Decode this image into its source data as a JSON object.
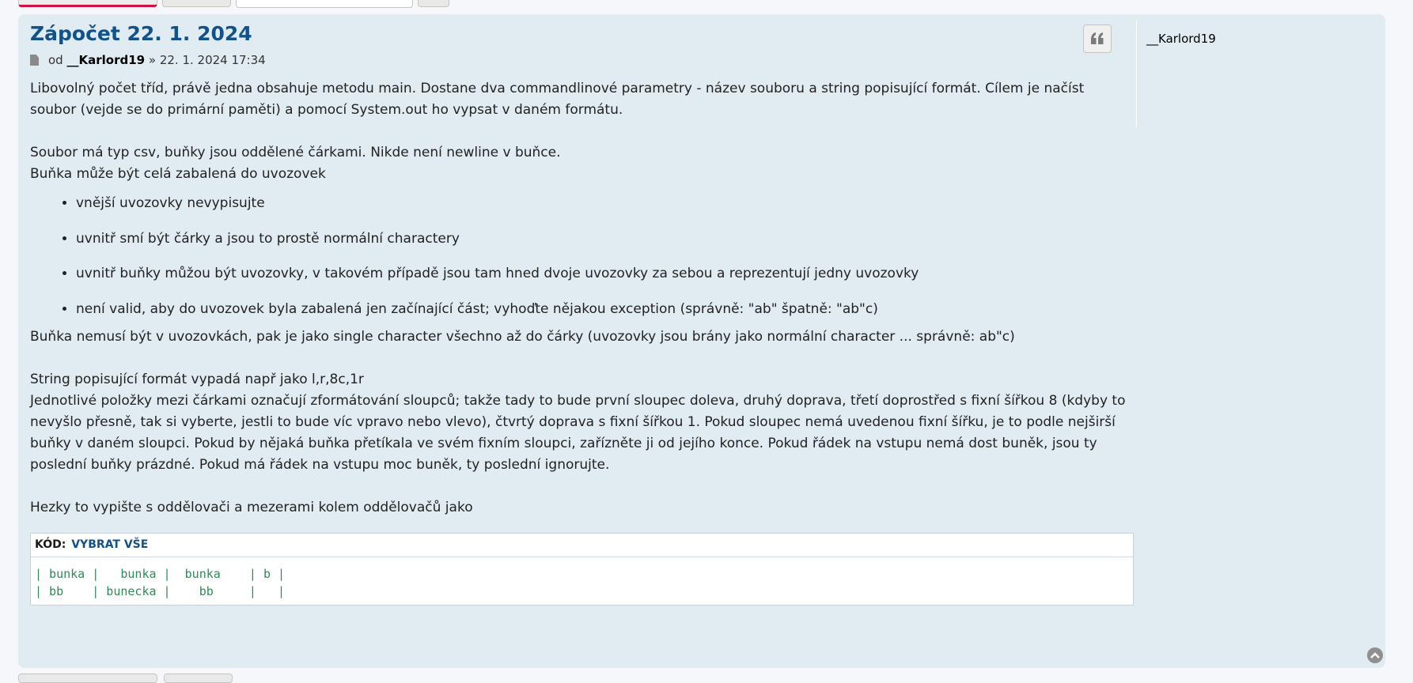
{
  "post": {
    "title": "Zápočet 22. 1. 2024",
    "author_prefix": "od",
    "author": "__Karlord19",
    "date": "» 22. 1. 2024 17:34",
    "content": {
      "p1": "Libovolný počet tříd, právě jedna obsahuje metodu main. Dostane dva commandlinové parametry - název souboru a string popisující formát. Cílem je načíst soubor (vejde se do primární paměti) a pomocí System.out ho vypsat v daném formátu.",
      "p2": "Soubor má typ csv, buňky jsou oddělené čárkami. Nikde není newline v buňce.",
      "p3": "Buňka může být celá zabalená do uvozovek",
      "list": [
        "vnější uvozovky nevypisujte",
        "uvnitř smí být čárky a jsou to prostě normální charactery",
        "uvnitř buňky můžou být uvozovky, v takovém případě jsou tam hned dvoje uvozovky za sebou a reprezentují jedny uvozovky",
        "není valid, aby do uvozovek byla zabalená jen začínající část; vyhoďte nějakou exception (správně: \"ab\" špatně: \"ab\"c)"
      ],
      "p4": "Buňka nemusí být v uvozovkách, pak je jako single character všechno až do čárky (uvozovky jsou brány jako normální character ... správně: ab\"c)",
      "p5": "String popisující formát vypadá např jako l,r,8c,1r",
      "p6": "Jednotlivé položky mezi čárkami označují zformátování sloupců; takže tady to bude první sloupec doleva, druhý doprava, třetí doprostřed s fixní šířkou 8 (kdyby to nevyšlo přesně, tak si vyberte, jestli to bude víc vpravo nebo vlevo), čtvrtý doprava s fixní šířkou 1. Pokud sloupec nemá uvedenou fixní šířku, je to podle nejširší buňky v daném sloupci. Pokud by nějaká buňka přetíkala ve svém fixním sloupci, zařízněte ji od jejího konce. Pokud řádek na vstupu nemá dost buněk, jsou ty poslední buňky prázdné. Pokud má řádek na vstupu moc buněk, ty poslední ignorujte.",
      "p7": "Hezky to vypište s oddělovači a mezerami kolem oddělovačů jako"
    },
    "code": {
      "label": "KÓD:",
      "select_all": "VYBRAT VŠE",
      "text": "| bunka |   bunka |  bunka    | b |\n| bb    | bunecka |    bb     |   |"
    }
  },
  "profile": {
    "username": "__Karlord19"
  },
  "icons": {
    "quote": "quote-icon",
    "post": "post-file-icon",
    "back_to_top": "chevron-up-circle-icon"
  },
  "colors": {
    "post_background": "#e1ebf2",
    "title": "#105289",
    "code_text": "#2e8b57"
  }
}
